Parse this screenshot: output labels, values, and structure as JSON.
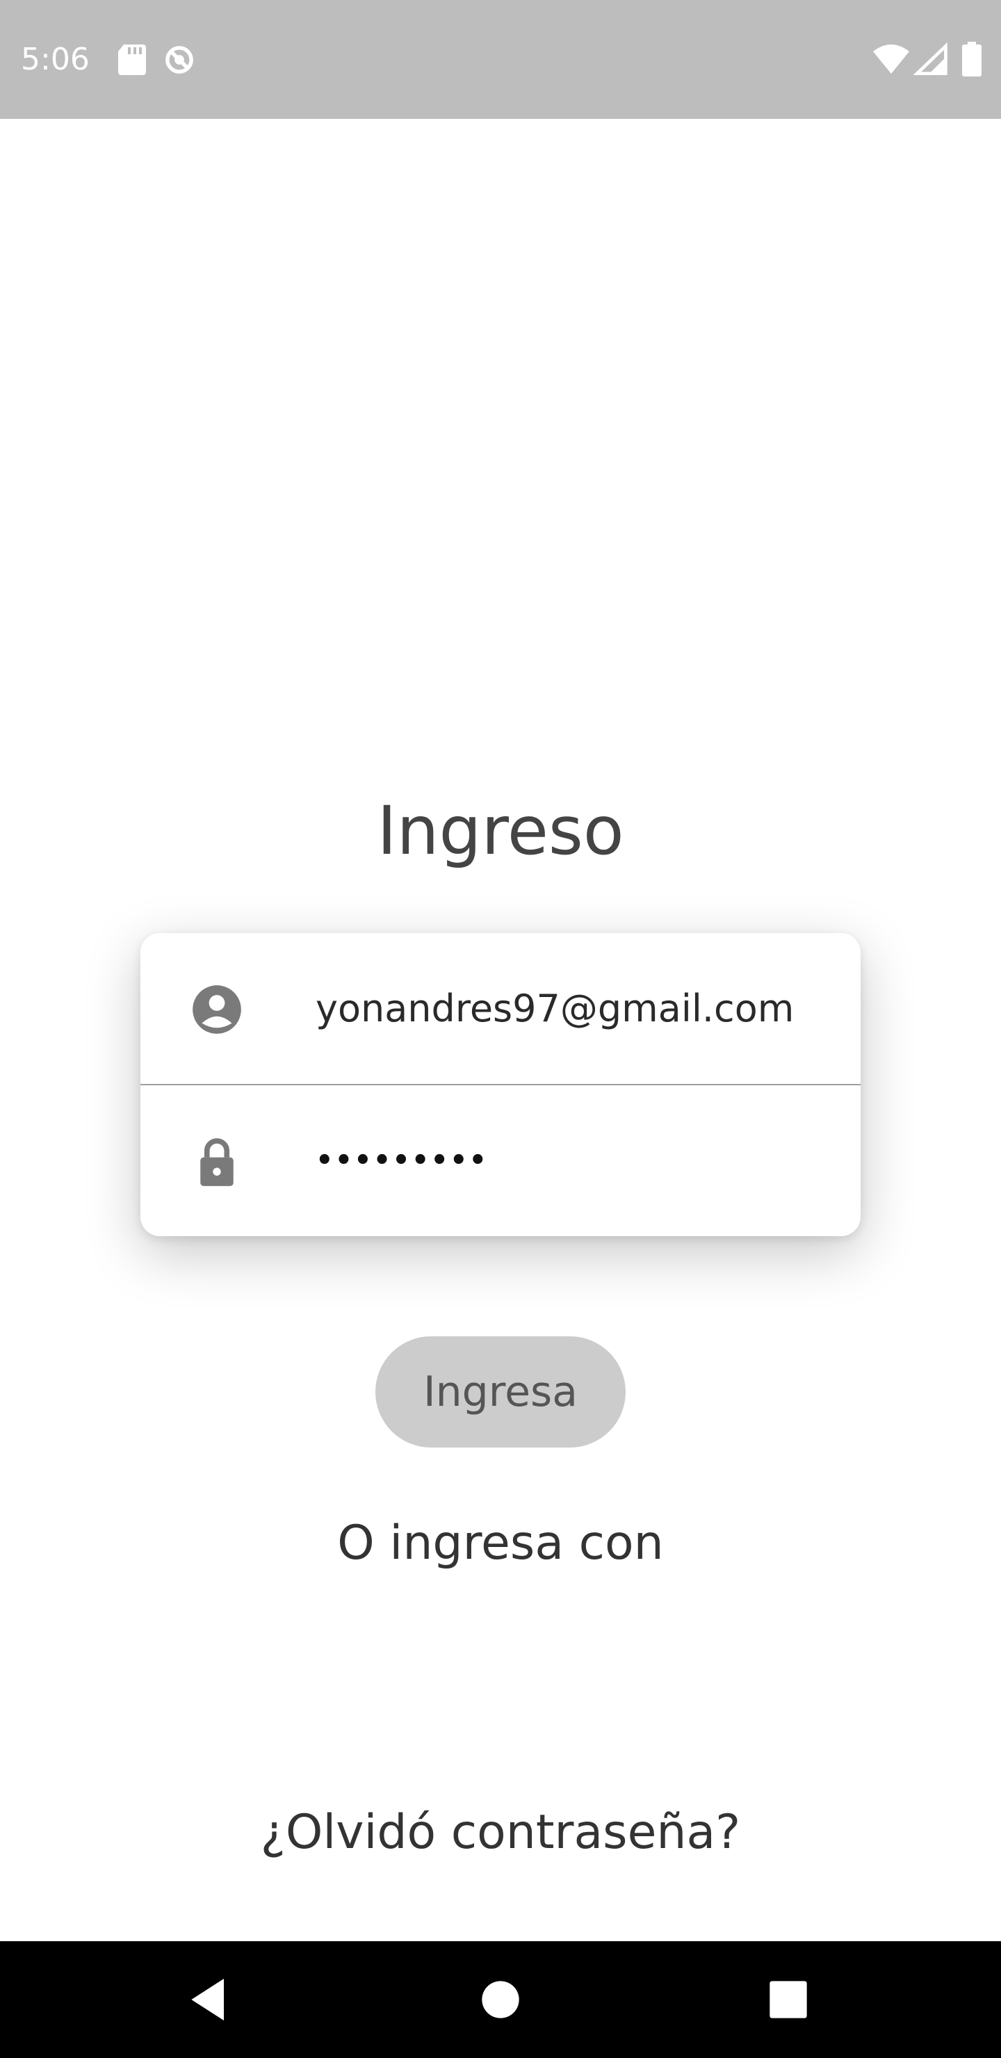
{
  "status_bar": {
    "time": "5:06",
    "icons": [
      "sd-card-icon",
      "sync-icon",
      "wifi-icon",
      "signal-icon",
      "battery-icon"
    ],
    "background": "#bdbdbd"
  },
  "login": {
    "title": "Ingreso",
    "email_value": "yonandres97@gmail.com",
    "email_icon": "account-circle-icon",
    "password_value": "•••••••••",
    "password_icon": "lock-icon",
    "submit_label": "Ingresa",
    "alt_login_text": "O ingresa con",
    "forgot_password": "¿Olvidó contraseña?"
  },
  "nav_bar": {
    "buttons": [
      "back-icon",
      "home-icon",
      "recents-icon"
    ]
  },
  "colors": {
    "button_bg": "#cccccc",
    "icon_gray": "#7a7a7a"
  }
}
